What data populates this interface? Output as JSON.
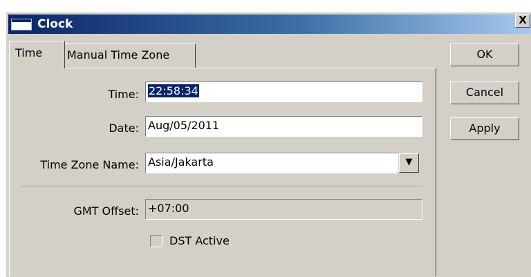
{
  "window": {
    "title": "Clock",
    "close_label": "X"
  },
  "tabs": [
    {
      "label": "Time",
      "active": true
    },
    {
      "label": "Manual Time Zone",
      "active": false
    }
  ],
  "form": {
    "time_label": "Time:",
    "time_value": "22:58:34",
    "date_label": "Date:",
    "date_value": "Aug/05/2011",
    "timezone_label": "Time Zone Name:",
    "timezone_value": "Asia/Jakarta",
    "gmt_label": "GMT Offset:",
    "gmt_value": "+07:00",
    "dst_label": "DST Active",
    "dst_checked": false
  },
  "buttons": {
    "ok": "OK",
    "cancel": "Cancel",
    "apply": "Apply"
  },
  "icons": {
    "dropdown": "dropdown-arrow-icon",
    "window": "window-icon"
  },
  "colors": {
    "titlebar_start": "#0a246a",
    "titlebar_end": "#a6caf0",
    "face": "#d4d0c8",
    "selection": "#0a246a"
  }
}
